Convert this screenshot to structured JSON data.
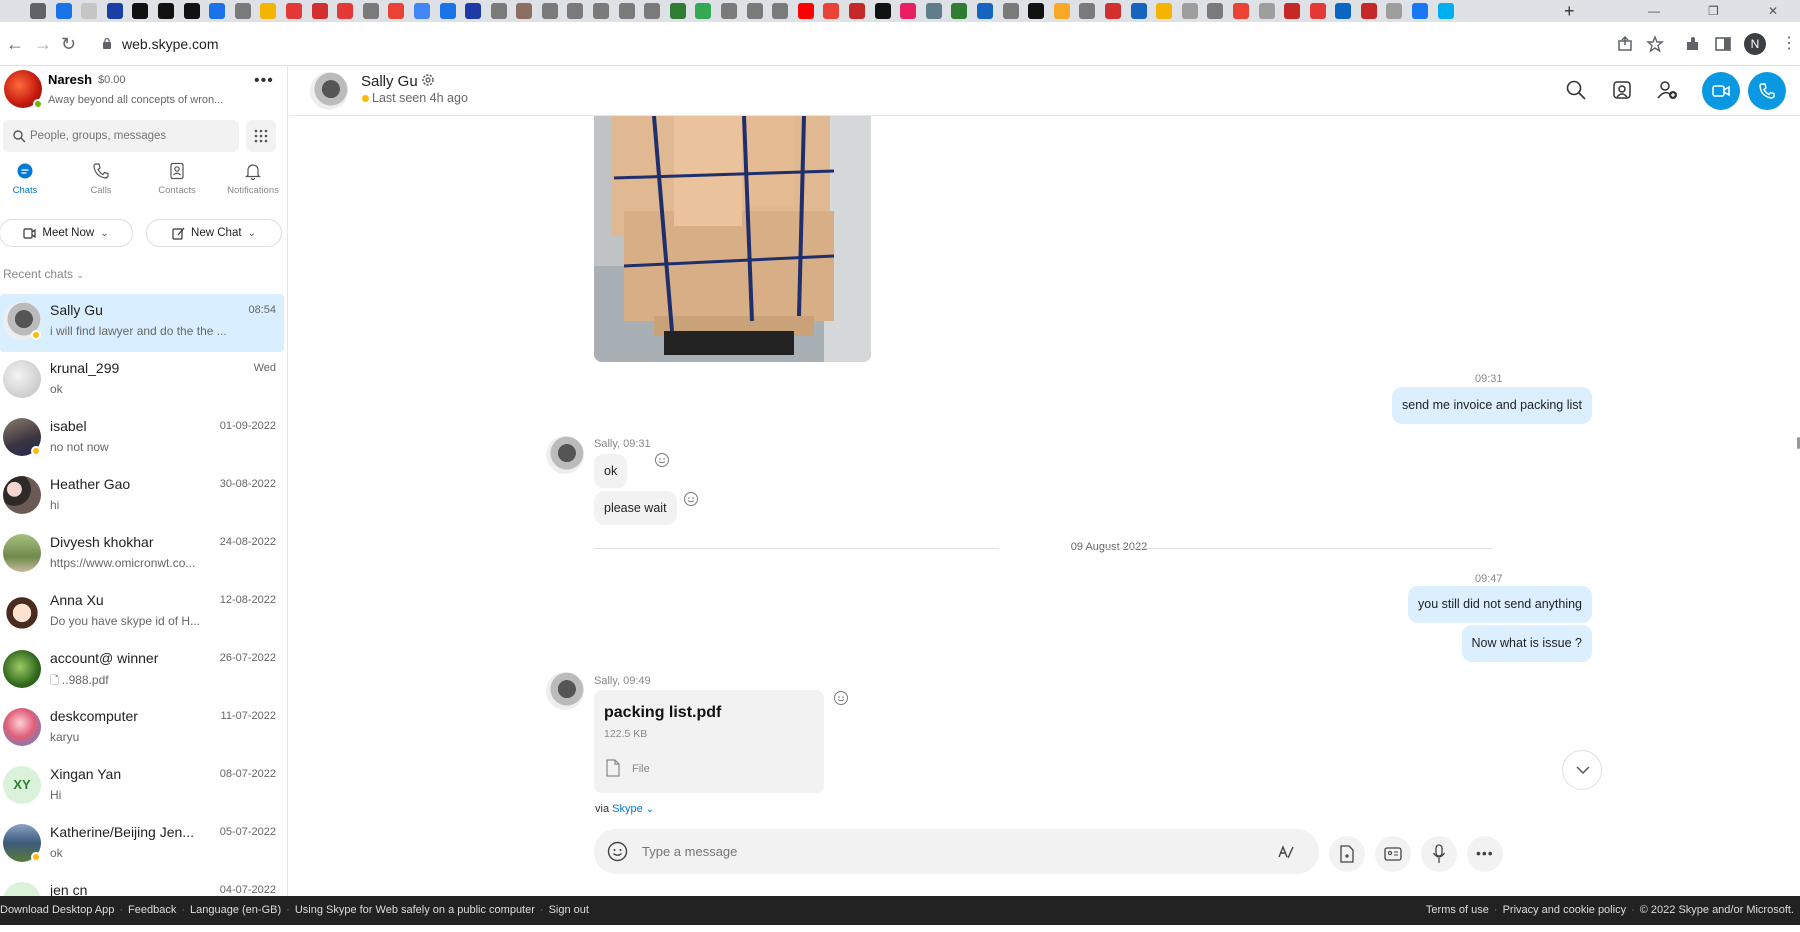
{
  "browser": {
    "url": "web.skype.com",
    "new_tab_symbol": "+",
    "profile_initial": "N",
    "tab_favicon_colors": [
      "#5f6368",
      "#1a73e8",
      "#c5c5c5",
      "#1a3fa6",
      "#111111",
      "#111111",
      "#111111",
      "#1a73e8",
      "#7a7a7a",
      "#f4b400",
      "#e53935",
      "#d32f2f",
      "#e53935",
      "#7a7a7a",
      "#ea4335",
      "#4285f4",
      "#1a73e8",
      "#1f3aa6",
      "#7a7a7a",
      "#8d6e63",
      "#7a7a7a",
      "#7a7a7a",
      "#7a7a7a",
      "#7a7a7a",
      "#7a7a7a",
      "#2e7d32",
      "#34a853",
      "#7a7a7a",
      "#7a7a7a",
      "#7a7a7a",
      "#ff0000",
      "#ea4335",
      "#c62828",
      "#111111",
      "#e91e63",
      "#607d8b",
      "#2e7d32",
      "#1565c0",
      "#7a7a7a",
      "#111111",
      "#f9a825",
      "#7a7a7a",
      "#d32f2f",
      "#1565c0",
      "#f4b400",
      "#9e9e9e",
      "#7a7a7a",
      "#ea4335",
      "#9e9e9e",
      "#c62828",
      "#e53935",
      "#0a66c2",
      "#c62828",
      "#9e9e9e",
      "#1877f2",
      "#00aff0"
    ]
  },
  "me": {
    "name": "Naresh",
    "credit": "$0.00",
    "mood": "Away beyond all concepts of wron...",
    "more_label": "•••"
  },
  "search": {
    "placeholder": "People, groups, messages"
  },
  "nav": {
    "tabs": [
      {
        "label": "Chats"
      },
      {
        "label": "Calls"
      },
      {
        "label": "Contacts"
      },
      {
        "label": "Notifications"
      }
    ],
    "meet_now_label": "Meet Now",
    "new_chat_label": "New Chat",
    "recent_chats_label": "Recent chats"
  },
  "chats": [
    {
      "name": "Sally Gu",
      "preview": "i will find lawyer and do the the ...",
      "date": "08:54",
      "avatar": "photo-dark",
      "presence": "away",
      "active": true
    },
    {
      "name": "krunal_299",
      "preview": "ok",
      "date": "Wed",
      "avatar": "photo-light"
    },
    {
      "name": "isabel",
      "preview": "no not now",
      "date": "01-09-2022",
      "avatar": "photo-person",
      "presence": "away"
    },
    {
      "name": "Heather Gao",
      "preview": "hi",
      "date": "30-08-2022",
      "avatar": "photo-flowers"
    },
    {
      "name": "Divyesh khokhar",
      "preview": "https://www.omicronwt.co...",
      "date": "24-08-2022",
      "avatar": "photo-outdoor"
    },
    {
      "name": "Anna Xu",
      "preview": "Do you have skype id of H...",
      "date": "12-08-2022",
      "avatar": "photo-cartoon"
    },
    {
      "name": "account@ winner",
      "preview": "..988.pdf",
      "preview_icon": "file",
      "date": "26-07-2022",
      "avatar": "photo-green"
    },
    {
      "name": "deskcomputer",
      "preview": "karyu",
      "date": "11-07-2022",
      "avatar": "photo-red"
    },
    {
      "name": "Xingan  Yan",
      "preview": "Hi",
      "date": "08-07-2022",
      "avatar": "initials",
      "initials": "XY"
    },
    {
      "name": "Katherine/Beijing Jen...",
      "preview": "ok",
      "date": "05-07-2022",
      "avatar": "photo-trees",
      "presence": "away"
    },
    {
      "name": "jen cn",
      "preview": "",
      "date": "04-07-2022",
      "avatar": "initials",
      "initials": ""
    }
  ],
  "conversation": {
    "name": "Sally Gu",
    "status": "Last seen 4h ago",
    "messages": {
      "t1": "09:31",
      "out1": "send me invoice and packing list",
      "in1_meta": "Sally, 09:31",
      "in1a": "ok",
      "in1b": "please wait",
      "date_separator": "09 August 2022",
      "t2": "09:47",
      "out2a": "you still did not send anything",
      "out2b": "Now what is issue ?",
      "in2_meta": "Sally, 09:49",
      "file_name": "packing list.pdf",
      "file_size": "122.5 KB",
      "file_type": "File",
      "via_prefix": "via ",
      "via_link": "Skype"
    },
    "composer_placeholder": "Type a message"
  },
  "footer": {
    "left_links": [
      "Download Desktop App",
      "Feedback",
      "Language (en-GB)",
      "Using Skype for Web safely on a public computer",
      "Sign out"
    ],
    "right_links": [
      "Terms of use",
      "Privacy and cookie policy",
      "© 2022 Skype and/or Microsoft."
    ]
  },
  "colors": {
    "accent": "#0a98e3",
    "selected_chat": "#d9efff",
    "outgoing_bubble": "#dcefff",
    "incoming_bubble": "#f2f2f2",
    "away": "#ffb900",
    "online": "#6bb700"
  }
}
